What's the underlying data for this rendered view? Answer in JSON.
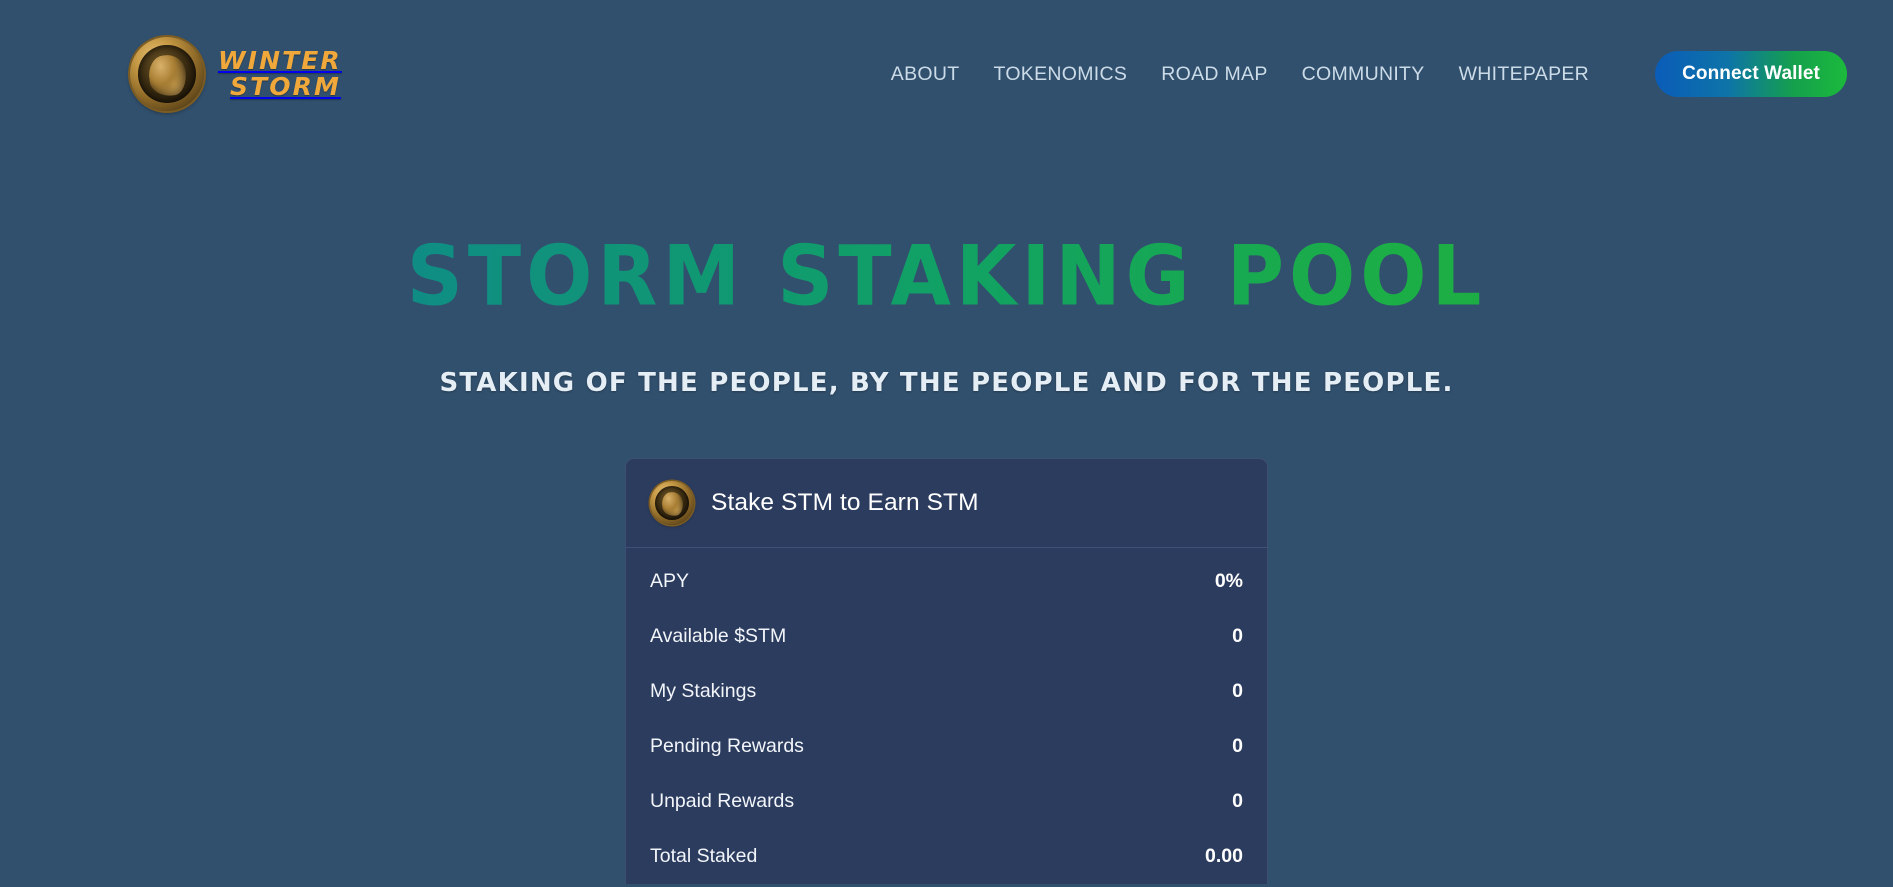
{
  "header": {
    "brand": {
      "logo_icon": "winter-storm-dragon-coin-icon",
      "line1": "WINTER",
      "line2": "STORM"
    },
    "nav": [
      {
        "label": "ABOUT"
      },
      {
        "label": "TOKENOMICS"
      },
      {
        "label": "ROAD MAP"
      },
      {
        "label": "COMMUNITY"
      },
      {
        "label": "WHITEPAPER"
      }
    ],
    "connect_wallet_label": "Connect Wallet",
    "connect_wallet_gradient_from": "#0a5cb8",
    "connect_wallet_gradient_to": "#1cba3c"
  },
  "hero": {
    "title": "STORM STAKING POOL",
    "title_gradient_from": "#17808f",
    "title_gradient_to": "#23a93e",
    "subtitle": "STAKING OF THE PEOPLE, BY THE PEOPLE AND FOR THE PEOPLE."
  },
  "stake_card": {
    "coin_icon": "stm-coin-icon",
    "title": "Stake STM to Earn STM",
    "stats": [
      {
        "label": "APY",
        "value": "0%"
      },
      {
        "label": "Available $STM",
        "value": "0"
      },
      {
        "label": "My Stakings",
        "value": "0"
      },
      {
        "label": "Pending Rewards",
        "value": "0"
      },
      {
        "label": "Unpaid Rewards",
        "value": "0"
      },
      {
        "label": "Total Staked",
        "value": "0.00"
      }
    ]
  },
  "theme": {
    "page_background": "#31506d",
    "card_background": "#2c3c5e",
    "nav_text": "#cbdbe8",
    "brand_gold": "#f0a83a"
  }
}
